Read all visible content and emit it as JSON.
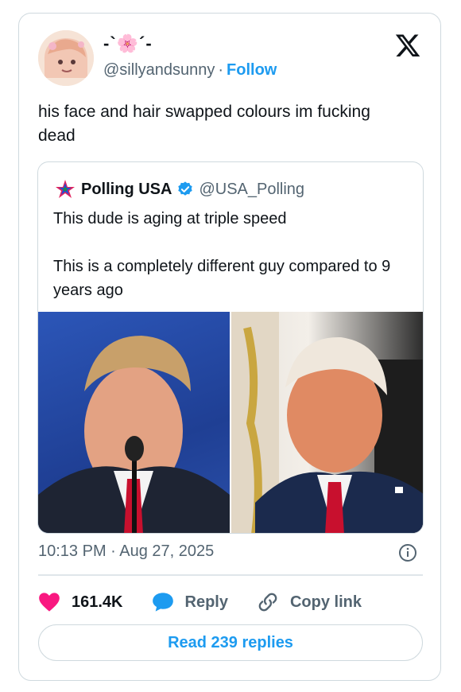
{
  "author": {
    "display_name": "-`🌸´-",
    "handle": "@sillyandsunny",
    "separator": "·",
    "follow_label": "Follow"
  },
  "tweet": {
    "text": "his face and hair swapped colours im fucking dead",
    "timestamp": "10:13 PM · Aug 27, 2025"
  },
  "quoted_tweet": {
    "name": "Polling USA",
    "handle": "@USA_Polling",
    "text_line1": "This dude is aging at triple speed",
    "text_line2": "This is a completely different guy compared to 9 years ago"
  },
  "actions": {
    "like_count": "161.4K",
    "reply_label": "Reply",
    "copy_link_label": "Copy link"
  },
  "read_replies_label": "Read 239 replies",
  "colors": {
    "link_blue": "#1d9bf0",
    "like_red": "#f91880",
    "text_primary": "#0f1419",
    "text_secondary": "#536471",
    "border": "#cfd9de"
  },
  "icons": [
    "x-logo-icon",
    "verified-badge-icon",
    "polling-logo-icon",
    "info-icon",
    "heart-icon",
    "reply-bubble-icon",
    "link-icon"
  ]
}
